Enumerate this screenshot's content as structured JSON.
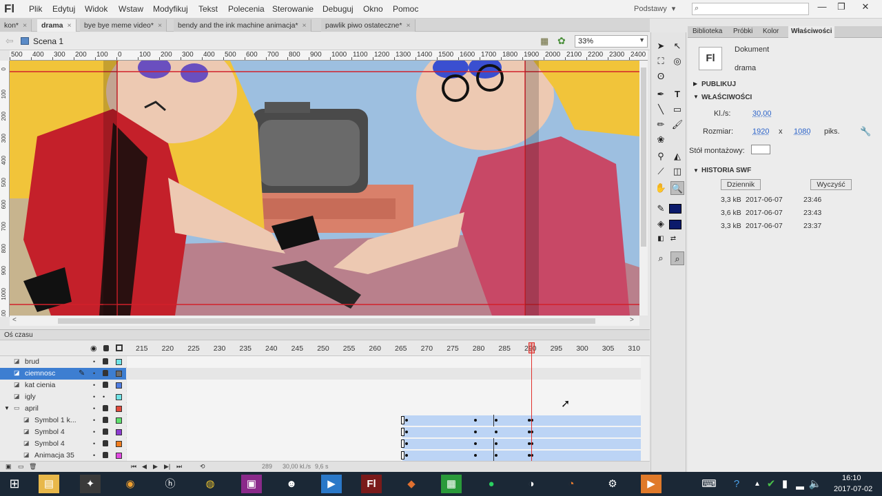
{
  "app": {
    "logo": "Fl",
    "menus": [
      "Plik",
      "Edytuj",
      "Widok",
      "Wstaw",
      "Modyfikuj",
      "Tekst",
      "Polecenia",
      "Sterowanie",
      "Debuguj",
      "Okno",
      "Pomoc"
    ],
    "workspace": "Podstawy",
    "workspace_arrow": "▾",
    "window_buttons": [
      "—",
      "❐",
      "✕"
    ]
  },
  "tabs": [
    {
      "label": "kon*",
      "close": "×",
      "active": false
    },
    {
      "label": "drama",
      "close": "×",
      "active": true
    },
    {
      "label": "bye bye meme video*",
      "close": "×",
      "active": false
    },
    {
      "label": "bendy and the ink machine animacja*",
      "close": "×",
      "active": false
    },
    {
      "label": "pawlik piwo ostateczne*",
      "close": "×",
      "active": false
    }
  ],
  "scene": {
    "label": "Scena 1",
    "zoom": "33%",
    "zoom_arrow": "▼"
  },
  "ruler_top": [
    "500",
    "400",
    "300",
    "200",
    "100",
    "0",
    "100",
    "200",
    "300",
    "400",
    "500",
    "600",
    "700",
    "800",
    "900",
    "1000",
    "1100",
    "1200",
    "1300",
    "1400",
    "1500",
    "1600",
    "1700",
    "1800",
    "1900",
    "2000",
    "2100",
    "2200",
    "2300",
    "2400"
  ],
  "ruler_left": [
    "0",
    "100",
    "200",
    "300",
    "400",
    "500",
    "600",
    "700",
    "800",
    "900",
    "1000",
    "1100"
  ],
  "timeline": {
    "title": "Oś czasu",
    "frame_numbers": [
      "215",
      "220",
      "225",
      "230",
      "235",
      "240",
      "245",
      "250",
      "255",
      "260",
      "265",
      "270",
      "275",
      "280",
      "285",
      "290",
      "295",
      "300",
      "305",
      "310"
    ],
    "layers": [
      {
        "name": "brud",
        "color": "#6fe3e6",
        "selected": false,
        "folder": false
      },
      {
        "name": "ciemnosc",
        "color": "#6e6e6e",
        "selected": true,
        "folder": false
      },
      {
        "name": "kat cienia",
        "color": "#4f7de2",
        "selected": false,
        "folder": false
      },
      {
        "name": "igly",
        "color": "#6fe3e6",
        "selected": false,
        "folder": false
      },
      {
        "name": "april",
        "color": "#e14a3b",
        "selected": false,
        "folder": true
      },
      {
        "name": "Symbol 1 k...",
        "color": "#5fe06d",
        "selected": false,
        "folder": false
      },
      {
        "name": "Symbol 4",
        "color": "#8c3bd0",
        "selected": false,
        "folder": false
      },
      {
        "name": "Symbol 4",
        "color": "#f07c1e",
        "selected": false,
        "folder": false
      },
      {
        "name": "Animacja 35",
        "color": "#e04ae0",
        "selected": false,
        "folder": false
      }
    ],
    "footer": {
      "frame": "289",
      "fps": "30,00 kl./s",
      "time": "9,6 s"
    }
  },
  "panel": {
    "tabs": [
      "Biblioteka",
      "Próbki",
      "Kolor",
      "Właściwości"
    ],
    "doc_type": "Dokument",
    "doc_name": "drama",
    "doc_icon": "Fl",
    "section_publish": "PUBLIKUJ",
    "section_props": "WŁAŚCIWOŚCI",
    "fps_label": "Kl./s:",
    "fps_value": "30,00",
    "size_label": "Rozmiar:",
    "width": "1920",
    "size_x": "x",
    "height": "1080",
    "size_unit": "piks.",
    "stage_label": "Stół montażowy:",
    "section_history": "HISTORIA SWF",
    "btn_log": "Dziennik",
    "btn_clear": "Wyczyść",
    "history": [
      {
        "size": "3,3 kB",
        "date": "2017-06-07",
        "time": "23:46"
      },
      {
        "size": "3,6 kB",
        "date": "2017-06-07",
        "time": "23:43"
      },
      {
        "size": "3,3 kB",
        "date": "2017-06-07",
        "time": "23:37"
      }
    ]
  },
  "taskbar": {
    "time": "16:10",
    "date": "2017-07-02"
  },
  "colors": {
    "accent": "#3d7ed1",
    "playhead": "#e0302b",
    "tween": "#bcd4f5",
    "taskbar": "#1b2836"
  }
}
